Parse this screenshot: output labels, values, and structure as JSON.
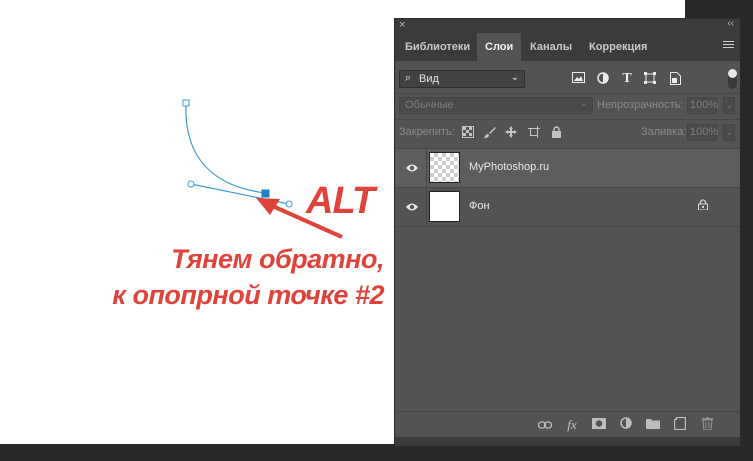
{
  "annotation": {
    "key": "ALT",
    "line1": "Тянем обратно,",
    "line2": "к опопрной точке #2",
    "color": "#e0433b"
  },
  "panel": {
    "close_glyph": "×",
    "collapse_glyph": "‹‹",
    "tabs": [
      {
        "label": "Библиотеки",
        "active": false
      },
      {
        "label": "Слои",
        "active": true
      },
      {
        "label": "Каналы",
        "active": false
      },
      {
        "label": "Коррекция",
        "active": false
      }
    ],
    "filter": {
      "label": "Вид",
      "icons": [
        "image-filter-icon",
        "adjustment-filter-icon",
        "type-filter-icon",
        "shape-filter-icon",
        "smart-object-filter-icon"
      ]
    },
    "blend_mode": "Обычные",
    "opacity_label": "Непрозрачность:",
    "opacity_value": "100%",
    "lock_label": "Закрепить:",
    "fill_label": "Заливка:",
    "fill_value": "100%",
    "layers": [
      {
        "name": "MyPhotoshop.ru",
        "selected": true,
        "locked": false,
        "transparent": true
      },
      {
        "name": "Фон",
        "selected": false,
        "locked": true,
        "transparent": false
      }
    ],
    "footer_icons": [
      "link-layers-icon",
      "fx-icon",
      "add-mask-icon",
      "adjustment-layer-icon",
      "new-group-icon",
      "new-layer-icon",
      "delete-layer-icon"
    ]
  }
}
